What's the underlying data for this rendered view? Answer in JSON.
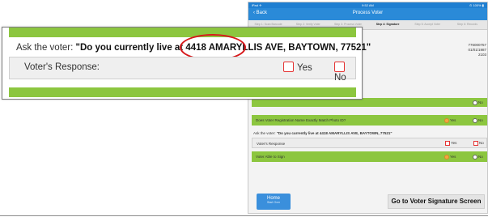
{
  "ipad": {
    "status_left": "iPad ✈",
    "status_center": "9:52 AM",
    "status_right": "⊙ 100% ▮",
    "back_label": "‹ Back",
    "title": "Process Voter",
    "steps": [
      "Step 1: Scan Barcode",
      "Step 2: Verify Voter",
      "Step 3: Process Voter",
      "Step 4: Signature",
      "Step 5: Accept Voter",
      "Step 6: Records"
    ],
    "info_lines": [
      "776000757",
      "01/01/1987",
      "2103"
    ],
    "row_id_match": "Does Voter Registration Name Exactly Match Photo ID?",
    "ask_prefix": "Ask the voter:",
    "ask_question": "\"Do you currently live at 4418 AMARYLLIS AVE, BAYTOWN, 77521\"",
    "voter_response_label": "Voter's Response",
    "row_able_sign": "Voter Able to Sign",
    "yes_label": "Yes",
    "no_label": "No",
    "home_label": "Home",
    "home_sub": "Start Over",
    "signature_button": "Go to Voter Signature Screen"
  },
  "callout": {
    "ask_prefix": "Ask the voter:",
    "ask_question": "\"Do you currently live at 4418 AMARYLLIS AVE, BAYTOWN, 77521\"",
    "voter_response_label": "Voter's Response:",
    "yes_label": "Yes",
    "no_label": "No"
  },
  "colors": {
    "accent_green": "#8cc63f",
    "nav_blue": "#2a8ad8",
    "highlight_red": "#d7191c",
    "selected_orange": "#f4a640"
  }
}
